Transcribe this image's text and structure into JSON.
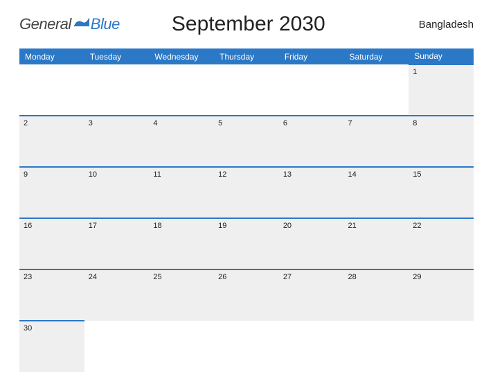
{
  "logo": {
    "general": "General",
    "blue": "Blue"
  },
  "title": "September 2030",
  "country": "Bangladesh",
  "weekdays": [
    "Monday",
    "Tuesday",
    "Wednesday",
    "Thursday",
    "Friday",
    "Saturday",
    "Sunday"
  ],
  "weeks": [
    [
      "",
      "",
      "",
      "",
      "",
      "",
      "1"
    ],
    [
      "2",
      "3",
      "4",
      "5",
      "6",
      "7",
      "8"
    ],
    [
      "9",
      "10",
      "11",
      "12",
      "13",
      "14",
      "15"
    ],
    [
      "16",
      "17",
      "18",
      "19",
      "20",
      "21",
      "22"
    ],
    [
      "23",
      "24",
      "25",
      "26",
      "27",
      "28",
      "29"
    ],
    [
      "30",
      "",
      "",
      "",
      "",
      "",
      ""
    ]
  ]
}
